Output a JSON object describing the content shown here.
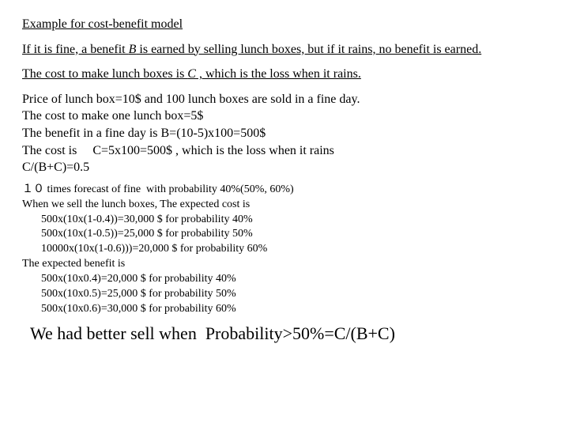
{
  "title": "Example for cost-benefit model",
  "para1_a": "If it is fine, a benefit ",
  "para1_var": "B",
  "para1_b": " is earned by selling lunch boxes, but if it rains, no benefit is earned.",
  "para2_a": "The cost to make lunch boxes is ",
  "para2_var": "C",
  "para2_b": " , which is the loss when it rains.",
  "block": {
    "l1": "Price of lunch box=10$ and 100 lunch boxes are sold in a fine day.",
    "l2": "The cost to make one lunch box=5$",
    "l3": "The benefit in a fine day is B=(10-5)x100=500$",
    "l4": "The cost is  C=5x100=500$ , which is the loss when it rains",
    "l5": "C/(B+C)=0.5"
  },
  "cost": {
    "h1a": "１０ times forecast of fine with probability ",
    "h1b": "40%(",
    "h1c": "50%, 60%)",
    "h2": "When we sell the lunch boxes, The expected cost is",
    "c1": "500x(10x(1-0.4))=30,000 $ for probability 40%",
    "c2": "500x(10x(1-0.5))=25,000 $ for probability 50%",
    "c3": "10000x(10x(1-0.6)))=20,000 $ for probability 60%",
    "bh": "The expected benefit is",
    "b1": "500x(10x0.4)=20,000 $ for probability 40%",
    "b2": "500x(10x0.5)=25,000 $ for probability 50%",
    "b3": "500x(10x0.6)=30,000 $ for probability 60%"
  },
  "conclusion": "We had better sell when Probability>50%=C/(B+C)"
}
